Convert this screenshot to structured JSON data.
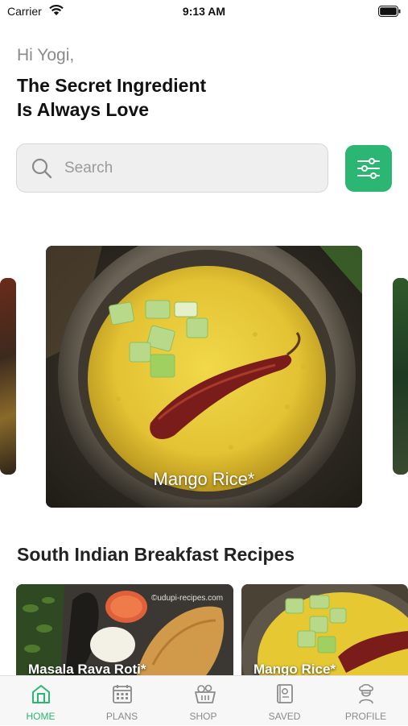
{
  "status_bar": {
    "carrier": "Carrier",
    "time": "9:13 AM"
  },
  "greeting": "Hi Yogi,",
  "headline": {
    "line1": "The Secret Ingredient",
    "line2": "Is Always Love"
  },
  "search": {
    "placeholder": "Search"
  },
  "featured": {
    "title": "Mango Rice*"
  },
  "section": {
    "title": "South Indian Breakfast Recipes"
  },
  "recipes": [
    {
      "title": "Masala Rava Roti*",
      "watermark": "©udupi-recipes.com"
    },
    {
      "title": "Mango Rice*"
    }
  ],
  "tabs": [
    {
      "label": "HOME",
      "icon": "home-icon",
      "active": true
    },
    {
      "label": "PLANS",
      "icon": "calendar-icon",
      "active": false
    },
    {
      "label": "SHOP",
      "icon": "basket-icon",
      "active": false
    },
    {
      "label": "SAVED",
      "icon": "bookmark-book-icon",
      "active": false
    },
    {
      "label": "PROFILE",
      "icon": "chef-icon",
      "active": false
    }
  ],
  "colors": {
    "accent": "#2bb673",
    "inactive": "#8a8a8a"
  }
}
